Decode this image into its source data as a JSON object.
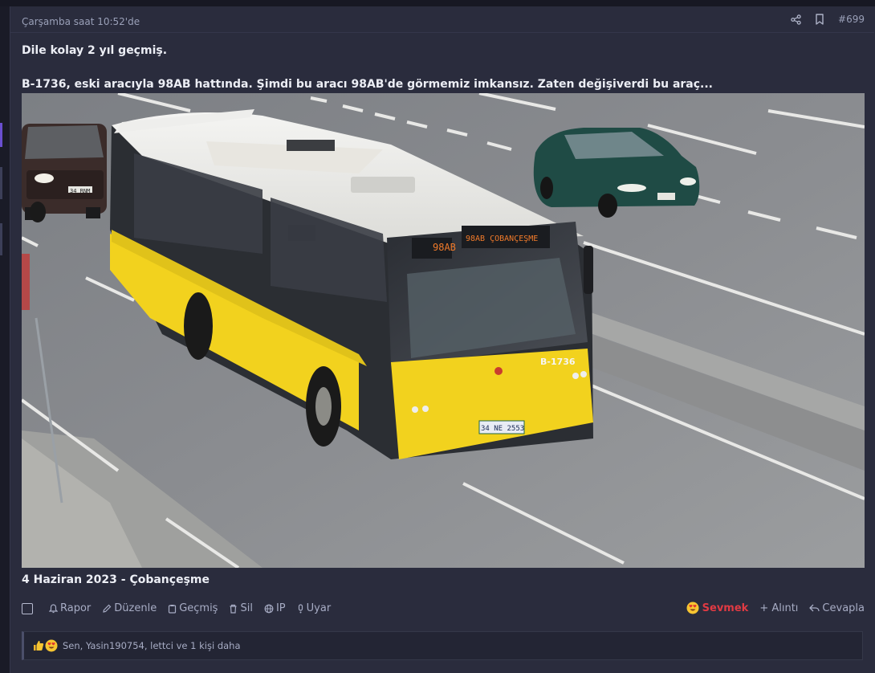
{
  "post": {
    "date": "Çarşamba saat 10:52'de",
    "number": "#699",
    "header_icons": [
      "share-icon",
      "bookmark-icon"
    ],
    "line1": "Dile kolay 2 yıl geçmiş.",
    "line2": "B-1736, eski aracıyla 98AB hattında. Şimdi bu aracı 98AB'de görmemiz imkansız. Zaten değişiverdi bu araç...",
    "photo": {
      "bus_number": "B-1736",
      "front_sign": "98AB ÇOBANÇEŞME",
      "side_sign": "98AB",
      "plate": "34 NE 2553",
      "oncoming_plate": "34 RNM"
    },
    "caption": "4 Haziran 2023 - Çobançeşme"
  },
  "actions": {
    "report": "Rapor",
    "edit": "Düzenle",
    "history": "Geçmiş",
    "delete": "Sil",
    "ip": "IP",
    "warn": "Uyar",
    "like": "Sevmek",
    "quote": "+ Alıntı",
    "reply": "Cevapla"
  },
  "reactions": {
    "text": "Sen, Yasin190754, lettci ve 1 kişi daha",
    "emoji": [
      "thumbs-up-icon",
      "heart-eyes-icon"
    ]
  },
  "colors": {
    "background": "#1f2130",
    "panel": "#2a2c3d",
    "muted_text": "#a7acc4",
    "like_red": "#e03a43",
    "bus_yellow": "#f2d21e"
  }
}
